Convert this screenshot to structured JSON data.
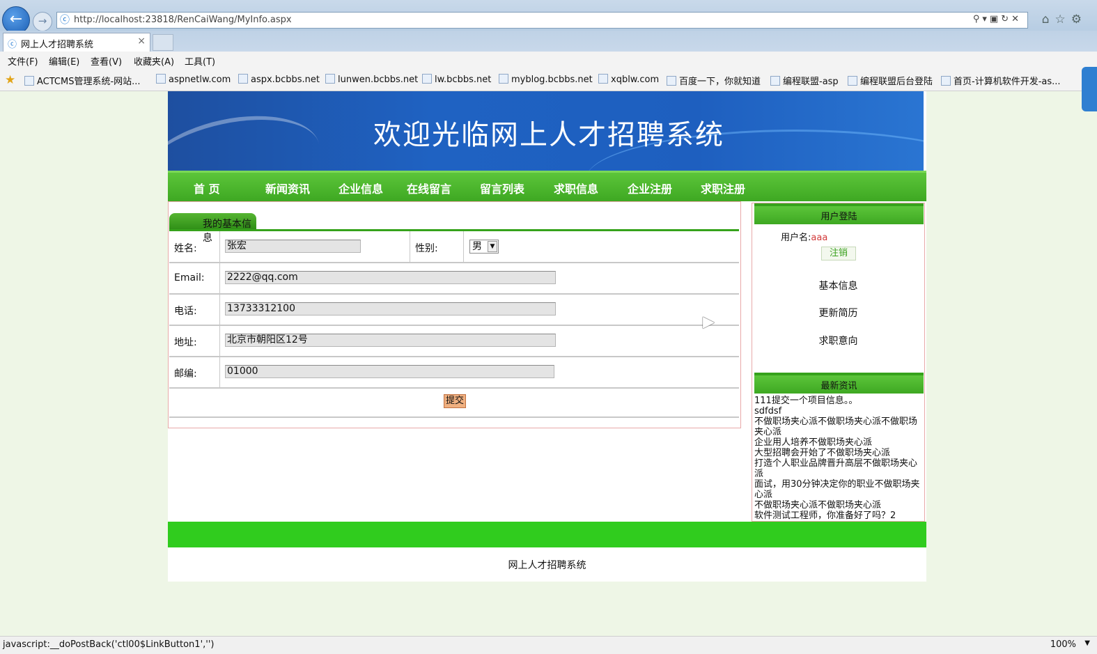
{
  "browser": {
    "url": "http://localhost:23818/RenCaiWang/MyInfo.aspx",
    "tab_title": "网上人才招聘系统",
    "tab_close": "×",
    "menu": [
      "文件(F)",
      "编辑(E)",
      "查看(V)",
      "收藏夹(A)",
      "工具(T)"
    ],
    "favorites": [
      "ACTCMS管理系统-网站...",
      "aspnetlw.com",
      "aspx.bcbbs.net",
      "lunwen.bcbbs.net",
      "lw.bcbbs.net",
      "myblog.bcbbs.net",
      "xqblw.com",
      "百度一下，你就知道",
      "编程联盟-asp",
      "编程联盟后台登陆",
      "首页-计算机软件开发-as..."
    ],
    "status_text": "javascript:__doPostBack('ctl00$LinkButton1','')",
    "zoom": "100%"
  },
  "site": {
    "banner_title": "欢迎光临网上人才招聘系统",
    "nav": [
      "首 页",
      "新闻资讯",
      "企业信息",
      "在线留言",
      "留言列表",
      "求职信息",
      "企业注册",
      "求职注册"
    ],
    "footer": "网上人才招聘系统"
  },
  "profile": {
    "section_title": "我的基本信息",
    "name_label": "姓名:",
    "name_value": "张宏",
    "gender_label": "性别:",
    "gender_value": "男",
    "email_label": "Email:",
    "email_value": "2222@qq.com",
    "phone_label": "电话:",
    "phone_value": "13733312100",
    "address_label": "地址:",
    "address_value": "北京市朝阳区12号",
    "zip_label": "邮编:",
    "zip_value": "01000",
    "submit_label": "提交"
  },
  "sidebar": {
    "login_title": "用户登陆",
    "username_label": "用户名:",
    "username_value": "aaa",
    "logout_label": "注销",
    "links": [
      "基本信息",
      "更新简历",
      "求职意向"
    ],
    "news_title": "最新资讯",
    "news": [
      "111提交一个项目信息。。",
      "sdfdsf",
      "不做职场夹心派不做职场夹心派不做职场夹心派",
      "企业用人培养不做职场夹心派",
      "大型招聘会开始了不做职场夹心派",
      "打造个人职业品牌晋升高层不做职场夹心派",
      "面试，用30分钟决定你的职业不做职场夹心派",
      "不做职场夹心派不做职场夹心派",
      "软件测试工程师，你准备好了吗？2"
    ]
  }
}
